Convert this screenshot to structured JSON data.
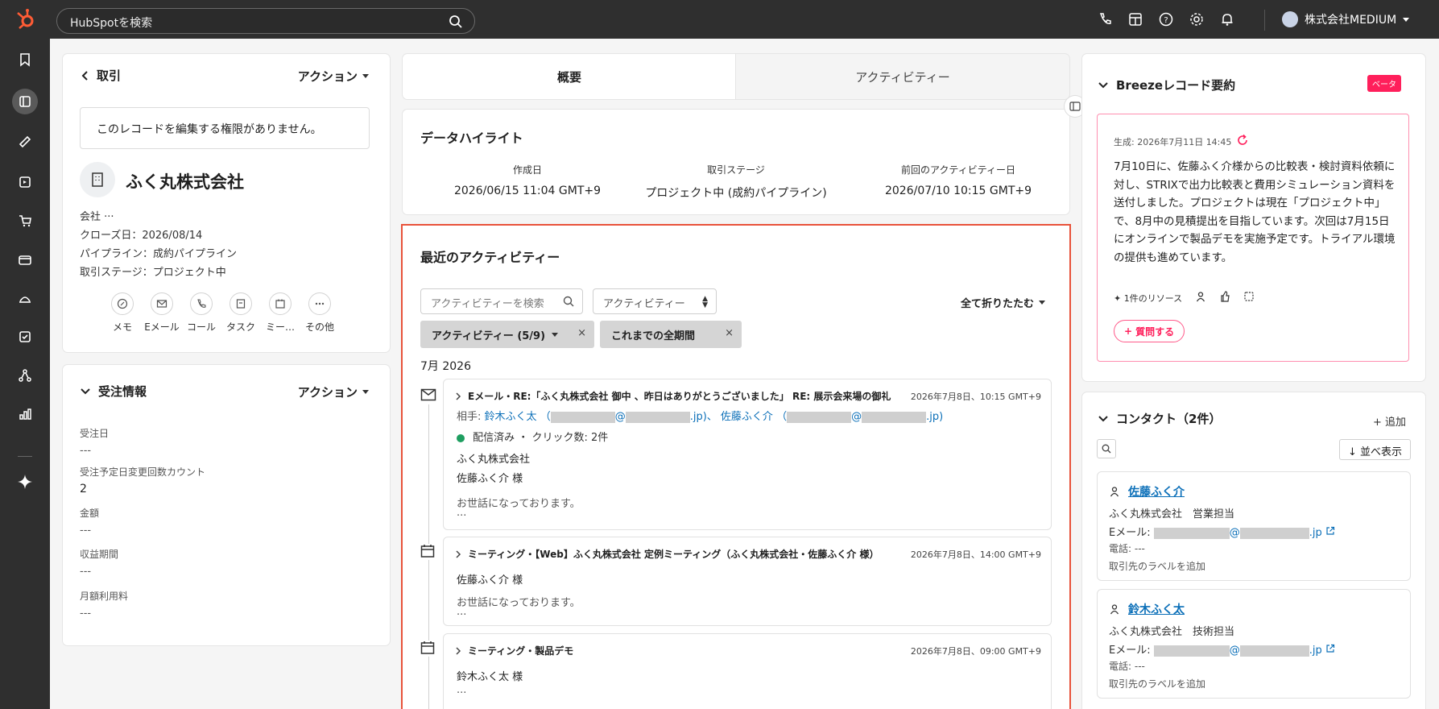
{
  "topbar": {
    "search_placeholder": "HubSpotを検索",
    "account_name": "株式会社MEDIUM"
  },
  "record": {
    "back_label": "取引",
    "action_label": "アクション",
    "notice": "このレコードを編集する権限がありません。",
    "company_name": "ふく丸株式会社",
    "props": [
      "会社 ···",
      "クローズ日：2026/08/14",
      "パイプライン：成約パイプライン",
      "取引ステージ：プロジェクト中"
    ],
    "quick_actions": [
      "メモ",
      "Eメール",
      "コール",
      "タスク",
      "ミー…",
      "その他"
    ]
  },
  "order": {
    "title": "受注情報",
    "action_label": "アクション",
    "fields": [
      {
        "label": "受注日",
        "value": "---"
      },
      {
        "label": "受注予定日変更回数カウント",
        "value": "2"
      },
      {
        "label": "金額",
        "value": "---"
      },
      {
        "label": "収益期間",
        "value": "---"
      },
      {
        "label": "月額利用料",
        "value": "---"
      }
    ]
  },
  "tabs": [
    "概要",
    "アクティビティー"
  ],
  "highlights": {
    "title": "データハイライト",
    "cols": [
      {
        "label": "作成日",
        "value": "2026/06/15 11:04 GMT+9"
      },
      {
        "label": "取引ステージ",
        "value": "プロジェクト中 (成約パイプライン)"
      },
      {
        "label": "前回のアクティビティー日",
        "value": "2026/07/10 10:15 GMT+9"
      }
    ]
  },
  "activity": {
    "title": "最近のアクティビティー",
    "search_placeholder": "アクティビティーを検索",
    "filter_label": "アクティビティー",
    "collapse_all": "全て折りたたむ",
    "chips": [
      "アクティビティー (5/9)",
      "これまでの全期間"
    ],
    "month": "7月 2026",
    "items": [
      {
        "title": "Eメール・RE:「ふく丸株式会社 御中 、昨日はありがとうございました」 RE: 展示会来場の御礼",
        "time": "2026年7月8日、10:15 GMT+9",
        "to_label": "相手:",
        "to_name1": "鈴木ふく太",
        "to_name2": "佐藤ふく介",
        "status": "配信済み",
        "clicks": "クリック数: 2件",
        "line1": "ふく丸株式会社",
        "line2": "佐藤ふく介 様",
        "line3": "お世話になっております。",
        "more": "..."
      },
      {
        "title": "ミーティング・【Web】ふく丸株式会社 定例ミーティング（ふく丸株式会社・佐藤ふく介 様）",
        "time": "2026年7月8日、14:00 GMT+9",
        "line1": "佐藤ふく介 様",
        "line2": "お世話になっております。",
        "more": "..."
      },
      {
        "title": "ミーティング・製品デモ",
        "time": "2026年7月8日、09:00 GMT+9",
        "line1": "鈴木ふく太 様",
        "more": "..."
      }
    ]
  },
  "breeze": {
    "title": "Breezeレコード要約",
    "badge": "ベータ",
    "generated": "生成: 2026年7月11日 14:45",
    "summary": "7月10日に、佐藤ふく介様からの比較表・検討資料依頼に対し、STRIXで出力比較表と費用シミュレーション資料を送付しました。プロジェクトは現在「プロジェクト中」で、8月中の見積提出を目指しています。次回は7月15日にオンラインで製品デモを実施予定です。トライアル環境の提供も進めています。",
    "sources": "1件のリソース",
    "ask": "質問する"
  },
  "contacts": {
    "title": "コンタクト（2件）",
    "add": "+ 追加",
    "sort": "↓ 並べ表示",
    "items": [
      {
        "name": "佐藤ふく介",
        "company": "ふく丸株式会社　営業担当",
        "email_label": "Eメール:",
        "email_domain": ".jp",
        "phone": "電話: ---",
        "label_add": "取引先のラベルを追加"
      },
      {
        "name": "鈴木ふく太",
        "company": "ふく丸株式会社　技術担当",
        "email_label": "Eメール:",
        "email_domain": ".jp",
        "phone": "電話: ---",
        "label_add": "取引先のラベルを追加"
      }
    ]
  },
  "colors": {
    "accent_red": "#e8523a",
    "brand_orange": "#ff5c35",
    "beta_pink": "#ff1f5b",
    "link_blue": "#0b6fb8"
  }
}
